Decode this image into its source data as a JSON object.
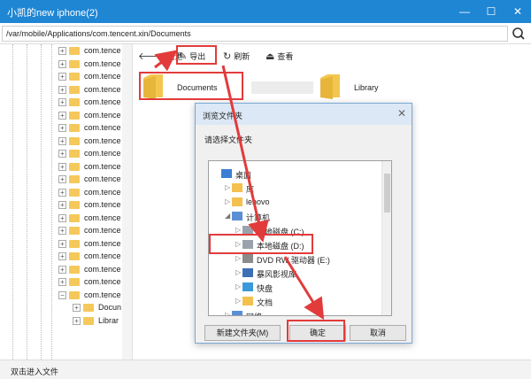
{
  "window": {
    "title": "小凯的new iphone(2)",
    "min": "—",
    "max": "☐",
    "close": "✕"
  },
  "path": {
    "value": "/var/mobile/Applications/com.tencent.xin/Documents"
  },
  "tree": {
    "items": [
      "com.tence",
      "com.tence",
      "com.tence",
      "com.tence",
      "com.tence",
      "com.tence",
      "com.tence",
      "com.tence",
      "com.tence",
      "com.tence",
      "com.tence",
      "com.tence",
      "com.tence",
      "com.tence",
      "com.tence",
      "com.tence",
      "com.tence",
      "com.tence",
      "com.tence",
      "com.tence"
    ],
    "children": [
      "Docun",
      "Librar"
    ]
  },
  "toolbar": {
    "back": "后退",
    "export": "导出",
    "refresh": "刷新",
    "view": "查看"
  },
  "files": [
    {
      "name": "Documents"
    },
    {
      "name": "Library"
    }
  ],
  "status": {
    "text": "双击进入文件"
  },
  "dialog": {
    "title": "浏览文件夹",
    "prompt": "请选择文件夹",
    "tree": [
      "桌面",
      "库",
      "lenovo",
      "计算机",
      "本地磁盘 (C:)",
      "本地磁盘 (D:)",
      "DVD RW 驱动器 (E:)",
      "暴风影视库",
      "快盘",
      "文档",
      "网络"
    ],
    "new_folder": "新建文件夹(M)",
    "ok": "确定",
    "cancel": "取消"
  }
}
